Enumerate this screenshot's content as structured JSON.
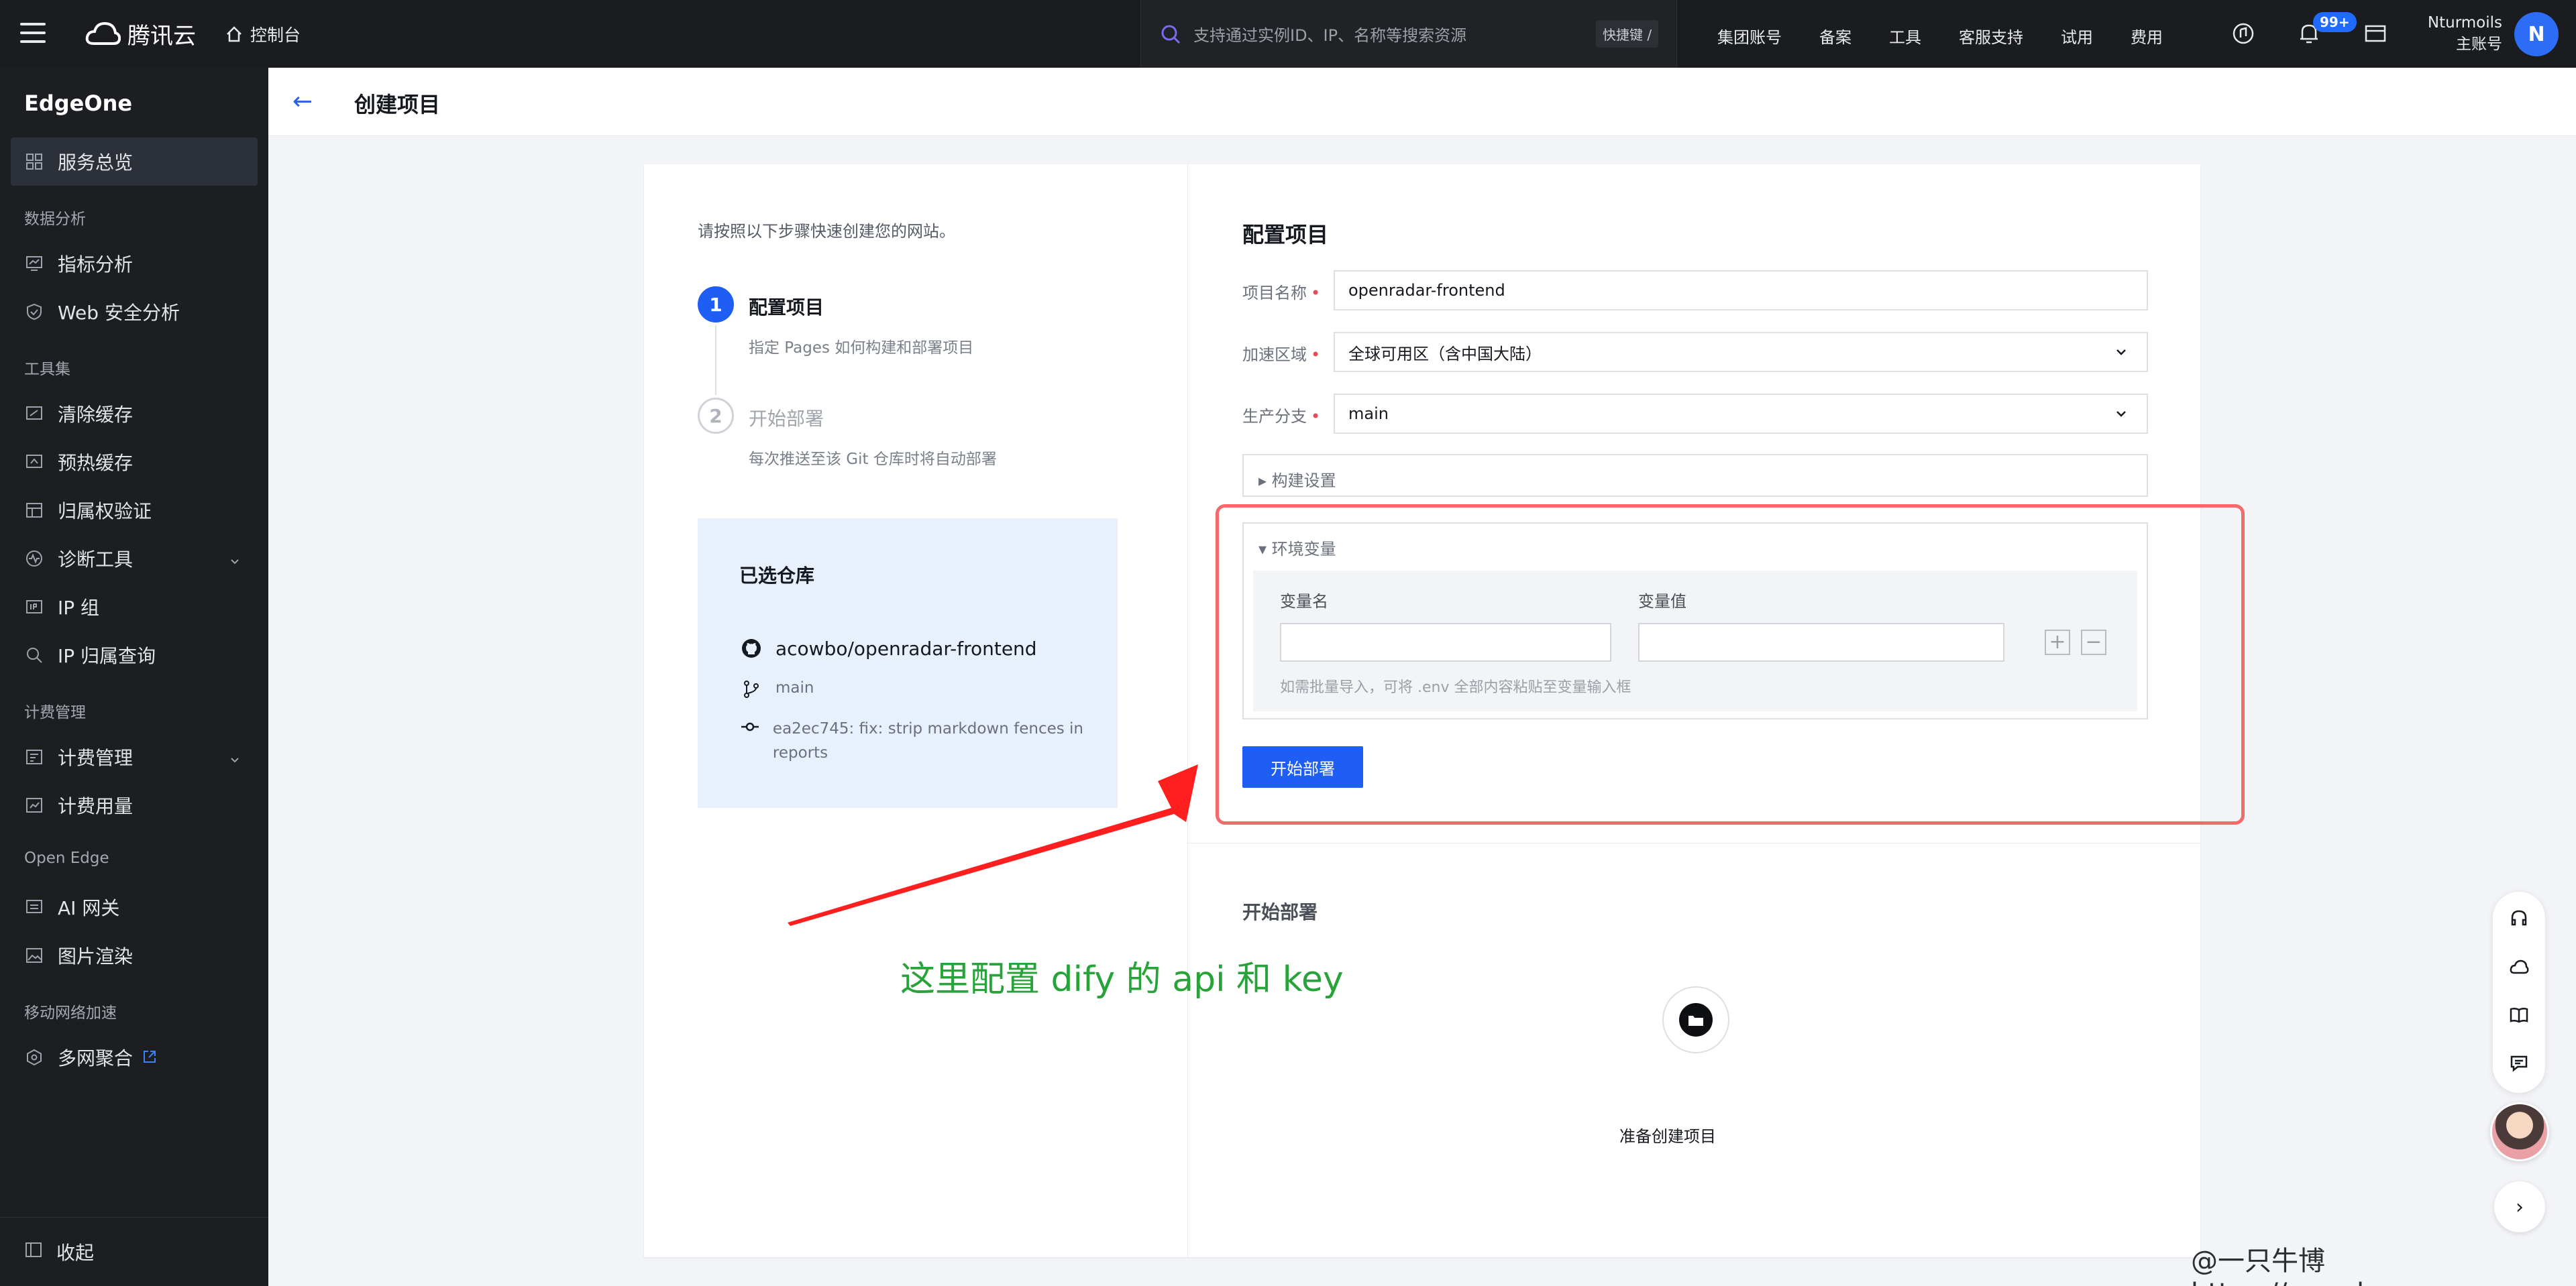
{
  "topbar": {
    "logo_text": "腾讯云",
    "console_label": "控制台",
    "search_placeholder": "支持通过实例ID、IP、名称等搜索资源",
    "shortcut_label": "快捷键 /",
    "nav_links": [
      "集团账号",
      "备案",
      "工具",
      "客服支持",
      "试用",
      "费用"
    ],
    "notification_badge": "99+",
    "account_name": "Nturmoils",
    "account_role": "主账号",
    "avatar_letter": "N"
  },
  "sidebar": {
    "product_name": "EdgeOne",
    "overview": "服务总览",
    "groups": {
      "data_analysis": "数据分析",
      "tools": "工具集",
      "billing": "计费管理",
      "open_edge": "Open Edge",
      "mobile": "移动网络加速"
    },
    "items": {
      "metrics": "指标分析",
      "web_security": "Web 安全分析",
      "purge_cache": "清除缓存",
      "prefetch_cache": "预热缓存",
      "ownership": "归属权验证",
      "diagnostics": "诊断工具",
      "ip_group": "IP 组",
      "ip_lookup": "IP 归属查询",
      "billing_mgmt": "计费管理",
      "billing_usage": "计费用量",
      "ai_gateway": "AI 网关",
      "image_render": "图片渲染",
      "multi_network": "多网聚合"
    },
    "collapse_label": "收起"
  },
  "page": {
    "back_icon": "arrow-left-icon",
    "title": "创建项目"
  },
  "steps": {
    "intro": "请按照以下步骤快速创建您的网站。",
    "step1": {
      "num": "1",
      "title": "配置项目",
      "desc": "指定 Pages 如何构建和部署项目"
    },
    "step2": {
      "num": "2",
      "title": "开始部署",
      "desc": "每次推送至该 Git 仓库时将自动部署"
    }
  },
  "repo": {
    "title": "已选仓库",
    "name": "acowbo/openradar-frontend",
    "branch": "main",
    "commit": "ea2ec745: fix: strip markdown fences in reports"
  },
  "config": {
    "title": "配置项目",
    "project_name_label": "项目名称",
    "project_name_value": "openradar-frontend",
    "region_label": "加速区域",
    "region_value": "全球可用区（含中国大陆）",
    "branch_label": "生产分支",
    "branch_value": "main",
    "build_settings_label": "▸ 构建设置",
    "env_label": "▾ 环境变量",
    "env_name_header": "变量名",
    "env_value_header": "变量值",
    "env_hint": "如需批量导入，可将 .env 全部内容粘贴至变量输入框",
    "deploy_button": "开始部署"
  },
  "deploy": {
    "title": "开始部署",
    "status": "准备创建项目"
  },
  "annotation": {
    "text": "这里配置 dify 的 api 和 key",
    "color": "#27a33a"
  },
  "watermark": "@一只牛博 https://acowbo.com",
  "colors": {
    "primary": "#1f5ef5",
    "annotation_red": "#f36a6a",
    "sidebar_bg": "#1c1e22",
    "repo_box_bg": "#e8f0fc"
  }
}
